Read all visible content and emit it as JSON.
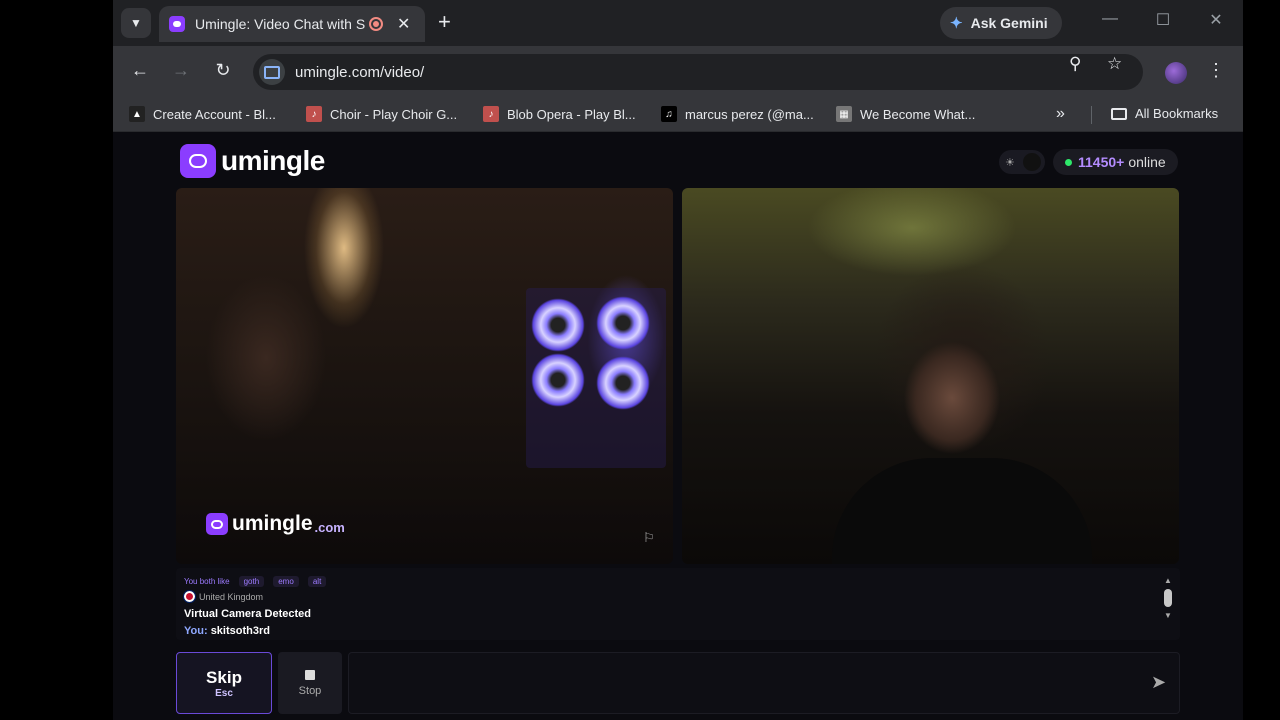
{
  "browser": {
    "tab": {
      "title": "Umingle: Video Chat with St"
    },
    "new_tab": "+",
    "ask_gemini": "Ask Gemini",
    "url": "umingle.com/video/",
    "bookmarks": [
      {
        "label": "Create Account - Bl...",
        "icon": "mountain-icon",
        "color": "#222222"
      },
      {
        "label": "Choir - Play Choir G...",
        "icon": "choir-icon",
        "color": "#c0504d"
      },
      {
        "label": "Blob Opera - Play Bl...",
        "icon": "blob-icon",
        "color": "#c0504d"
      },
      {
        "label": "marcus perez (@ma...",
        "icon": "tiktok-icon",
        "color": "#000000"
      },
      {
        "label": "We Become What...",
        "icon": "game-icon",
        "color": "#777777"
      }
    ],
    "all_bookmarks": "All Bookmarks"
  },
  "app": {
    "logo": "umingle",
    "online_count": "11450+",
    "online_label": "online",
    "watermark": "umingle",
    "watermark_suffix": ".com",
    "accent": "#8b3dff"
  },
  "chat": {
    "interest_prefix": "You both like",
    "interests": [
      "goth",
      "emo",
      "alt"
    ],
    "country": "United Kingdom",
    "system_message": "Virtual Camera Detected",
    "you_label": "You:",
    "you_message": "skitsoth3rd"
  },
  "controls": {
    "skip_label": "Skip",
    "skip_key": "Esc",
    "stop_label": "Stop",
    "message_value": ""
  }
}
